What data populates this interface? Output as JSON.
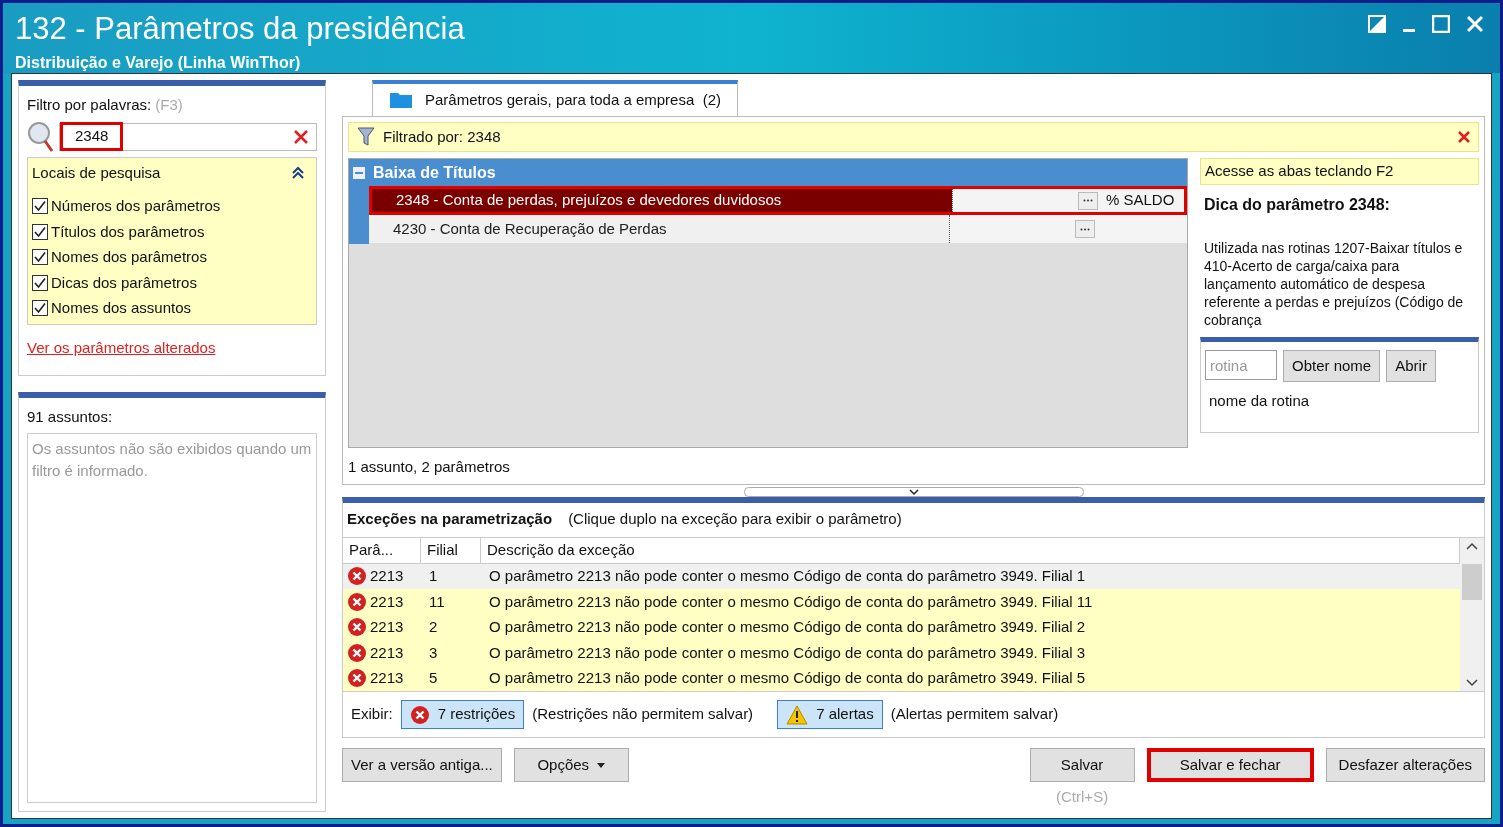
{
  "window": {
    "title": "132 - Parâmetros da presidência",
    "subtitle": "Distribuição e Varejo (Linha WinThor)"
  },
  "filter": {
    "label": "Filtro por palavras:",
    "hint": "(F3)",
    "value": "2348",
    "highlighted": true
  },
  "search_locations": {
    "title": "Locais de pesquisa",
    "expanded": true,
    "options": [
      {
        "label": "Números dos parâmetros",
        "checked": true
      },
      {
        "label": "Títulos dos parâmetros",
        "checked": true
      },
      {
        "label": "Nomes dos parâmetros",
        "checked": true
      },
      {
        "label": "Dicas dos parâmetros",
        "checked": true
      },
      {
        "label": "Nomes dos assuntos",
        "checked": true
      }
    ]
  },
  "changed_link": "Ver os parâmetros alterados",
  "subjects": {
    "count_label": "91 assuntos:",
    "message": "Os assuntos não são exibidos quando um filtro é informado."
  },
  "tabs": [
    {
      "label": "Parâmetros gerais, para toda a empresa  (2)",
      "selected": true
    }
  ],
  "filter_bar": {
    "text": "Filtrado por: 2348"
  },
  "group": {
    "title": "Baixa de Títulos",
    "expanded": true,
    "rows": [
      {
        "label": "2348 - Conta de perdas, prejuízos e devedores duvidosos",
        "value": "% SALDO",
        "selected": true,
        "highlighted": true
      },
      {
        "label": "4230 - Conta de Recuperação de Perdas",
        "selected": false,
        "highlighted": false
      }
    ]
  },
  "summary": "1 assunto, 2 parâmetros",
  "tip": {
    "hint": "Acesse as abas teclando F2",
    "title": "Dica do parâmetro 2348:",
    "text": "Utilizada nas rotinas 1207-Baixar títulos e 410-Acerto de carga/caixa para lançamento automático de despesa referente a perdas e prejuízos (Código de cobrança"
  },
  "routine": {
    "placeholder": "rotina",
    "buttons": [
      "Obter nome",
      "Abrir"
    ],
    "name_label": "nome da rotina"
  },
  "exceptions": {
    "title": "Exceções na parametrização",
    "note": "(Clique duplo na exceção para exibir o parâmetro)",
    "columns": [
      "Parâ...",
      "Filial",
      "Descrição da exceção"
    ],
    "rows": [
      {
        "param": "2213",
        "branch": "1",
        "description": "O parâmetro 2213 não pode conter o mesmo Código de conta do parâmetro 3949. Filial 1",
        "selected": true
      },
      {
        "param": "2213",
        "branch": "11",
        "description": "O parâmetro 2213 não pode conter o mesmo Código de conta do parâmetro 3949. Filial 11",
        "selected": false
      },
      {
        "param": "2213",
        "branch": "2",
        "description": "O parâmetro 2213 não pode conter o mesmo Código de conta do parâmetro 3949. Filial 2",
        "selected": false
      },
      {
        "param": "2213",
        "branch": "3",
        "description": "O parâmetro 2213 não pode conter o mesmo Código de conta do parâmetro 3949. Filial 3",
        "selected": false
      },
      {
        "param": "2213",
        "branch": "5",
        "description": "O parâmetro 2213 não pode conter o mesmo Código de conta do parâmetro 3949. Filial 5",
        "selected": false
      }
    ],
    "show_label": "Exibir:",
    "toggles": [
      {
        "kind": "error",
        "label": "7 restrições",
        "note": "(Restrições não permitem salvar)",
        "selected": true
      },
      {
        "kind": "warning",
        "label": "7 alertas",
        "note": "(Alertas permitem salvar)",
        "selected": true
      }
    ]
  },
  "left_buttons": [
    {
      "label": "Ver a versão antiga...",
      "kind": "plain"
    },
    {
      "label": "Opções",
      "kind": "menu"
    }
  ],
  "right_buttons": [
    {
      "label": "Salvar",
      "shortcut": "(Ctrl+S)",
      "highlighted": false
    },
    {
      "label": "Salvar e fechar",
      "highlighted": true
    },
    {
      "label": "Desfazer alterações",
      "highlighted": false
    }
  ]
}
